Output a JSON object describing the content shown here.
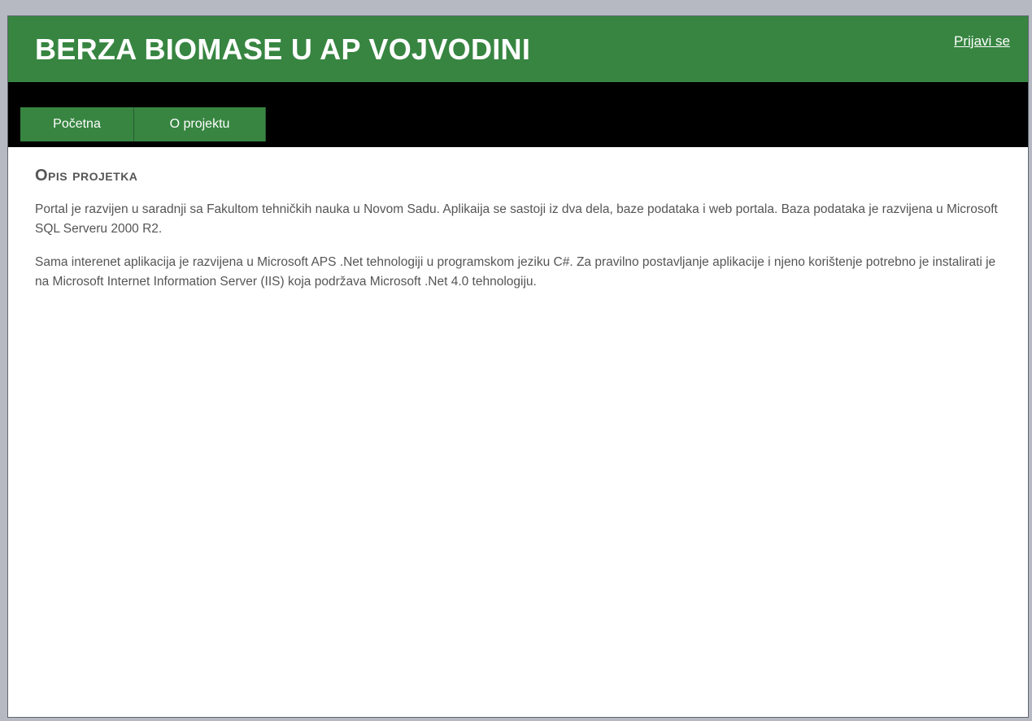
{
  "header": {
    "title": "BERZA BIOMASE U AP VOJVODINI",
    "login_label": "Prijavi se"
  },
  "nav": {
    "items": [
      {
        "label": "Početna"
      },
      {
        "label": "O projektu"
      }
    ]
  },
  "content": {
    "title": "Opis projetka",
    "paragraphs": [
      "Portal je razvijen u saradnji sa Fakultom tehničkih nauka u Novom Sadu. Aplikaija se sastoji iz dva dela, baze podataka i web portala. Baza podataka je razvijena u Microsoft SQL Serveru 2000 R2.",
      "Sama interenet aplikacija je razvijena u Microsoft APS .Net tehnologiji u programskom jeziku C#. Za pravilno postavljanje aplikacije i njeno korištenje potrebno je instalirati je na Microsoft Internet Information Server (IIS) koja podržava Microsoft .Net 4.0 tehnologiju."
    ]
  },
  "colors": {
    "header_green": "#378541",
    "nav_black": "#000000",
    "text_gray": "#555555",
    "window_border": "#b6b8c2"
  }
}
